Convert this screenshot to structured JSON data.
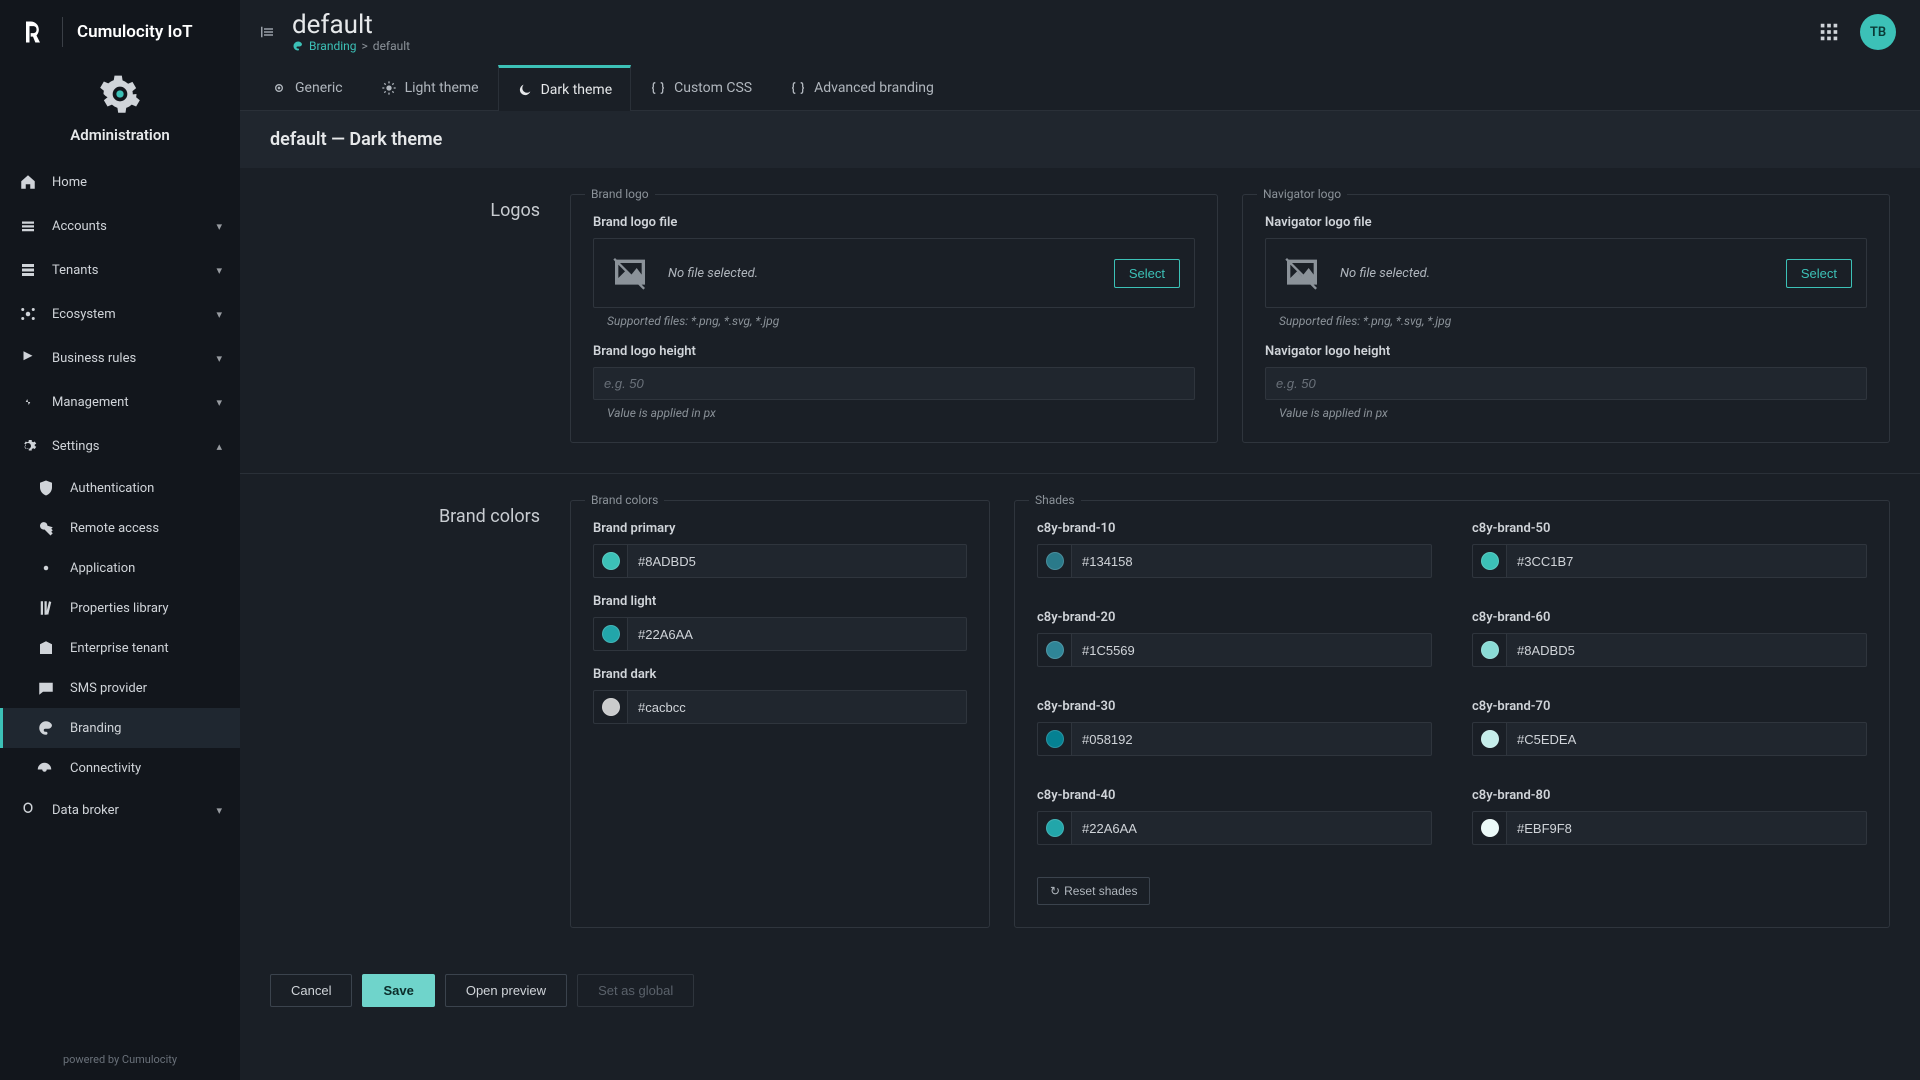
{
  "brand": {
    "product": "Cumulocity IoT"
  },
  "app_block": {
    "title": "Administration"
  },
  "sidebar": {
    "items": [
      {
        "label": "Home",
        "icon": "home-icon",
        "expandable": false
      },
      {
        "label": "Accounts",
        "icon": "accounts-icon",
        "expandable": true
      },
      {
        "label": "Tenants",
        "icon": "tenants-icon",
        "expandable": true
      },
      {
        "label": "Ecosystem",
        "icon": "ecosystem-icon",
        "expandable": true
      },
      {
        "label": "Business rules",
        "icon": "rules-icon",
        "expandable": true
      },
      {
        "label": "Management",
        "icon": "management-icon",
        "expandable": true
      },
      {
        "label": "Settings",
        "icon": "settings-icon",
        "expandable": true,
        "expanded": true
      }
    ],
    "settings_children": [
      {
        "label": "Authentication",
        "icon": "shield-icon"
      },
      {
        "label": "Remote access",
        "icon": "key-icon"
      },
      {
        "label": "Application",
        "icon": "cog-small-icon"
      },
      {
        "label": "Properties library",
        "icon": "library-icon"
      },
      {
        "label": "Enterprise tenant",
        "icon": "enterprise-icon"
      },
      {
        "label": "SMS provider",
        "icon": "sms-icon"
      },
      {
        "label": "Branding",
        "icon": "palette-icon",
        "active": true
      },
      {
        "label": "Connectivity",
        "icon": "connectivity-icon"
      }
    ],
    "last": {
      "label": "Data broker",
      "icon": "broker-icon",
      "expandable": true
    },
    "footer": "powered by Cumulocity"
  },
  "header": {
    "title": "default",
    "breadcrumb": {
      "link": "Branding",
      "sep": ">",
      "current": "default"
    },
    "avatar": "TB"
  },
  "tabs": [
    {
      "label": "Generic",
      "icon": "generic-icon"
    },
    {
      "label": "Light theme",
      "icon": "sun-icon"
    },
    {
      "label": "Dark theme",
      "icon": "moon-icon",
      "active": true
    },
    {
      "label": "Custom CSS",
      "icon": "braces-icon"
    },
    {
      "label": "Advanced branding",
      "icon": "braces-icon"
    }
  ],
  "subheader": "default — Dark theme",
  "logos": {
    "section_label": "Logos",
    "brand": {
      "legend": "Brand logo",
      "file_label": "Brand logo file",
      "no_file": "No file selected.",
      "select": "Select",
      "supported": "Supported files: *.png, *.svg, *.jpg",
      "height_label": "Brand logo height",
      "height_placeholder": "e.g. 50",
      "height_hint": "Value is applied in px"
    },
    "nav": {
      "legend": "Navigator logo",
      "file_label": "Navigator logo file",
      "no_file": "No file selected.",
      "select": "Select",
      "supported": "Supported files: *.png, *.svg, *.jpg",
      "height_label": "Navigator logo height",
      "height_placeholder": "e.g. 50",
      "height_hint": "Value is applied in px"
    }
  },
  "colors": {
    "section_label": "Brand colors",
    "brand_legend": "Brand colors",
    "shades_legend": "Shades",
    "brand_fields": [
      {
        "label": "Brand primary",
        "value": "#8ADBD5",
        "swatch": "#3cc1b7"
      },
      {
        "label": "Brand light",
        "value": "#22A6AA",
        "swatch": "#22A6AA"
      },
      {
        "label": "Brand dark",
        "value": "#cacbcc",
        "swatch": "#cacbcc"
      }
    ],
    "shade_fields": [
      {
        "label": "c8y-brand-10",
        "value": "#134158",
        "swatch": "#2a7a8a"
      },
      {
        "label": "c8y-brand-50",
        "value": "#3CC1B7",
        "swatch": "#3cc1b7"
      },
      {
        "label": "c8y-brand-20",
        "value": "#1C5569",
        "swatch": "#2f8597"
      },
      {
        "label": "c8y-brand-60",
        "value": "#8ADBD5",
        "swatch": "#8ADBD5"
      },
      {
        "label": "c8y-brand-30",
        "value": "#058192",
        "swatch": "#058192"
      },
      {
        "label": "c8y-brand-70",
        "value": "#C5EDEA",
        "swatch": "#C5EDEA"
      },
      {
        "label": "c8y-brand-40",
        "value": "#22A6AA",
        "swatch": "#22A6AA"
      },
      {
        "label": "c8y-brand-80",
        "value": "#EBF9F8",
        "swatch": "#EBF9F8"
      }
    ],
    "reset": "Reset shades"
  },
  "footer": {
    "cancel": "Cancel",
    "save": "Save",
    "preview": "Open preview",
    "global": "Set as global"
  }
}
